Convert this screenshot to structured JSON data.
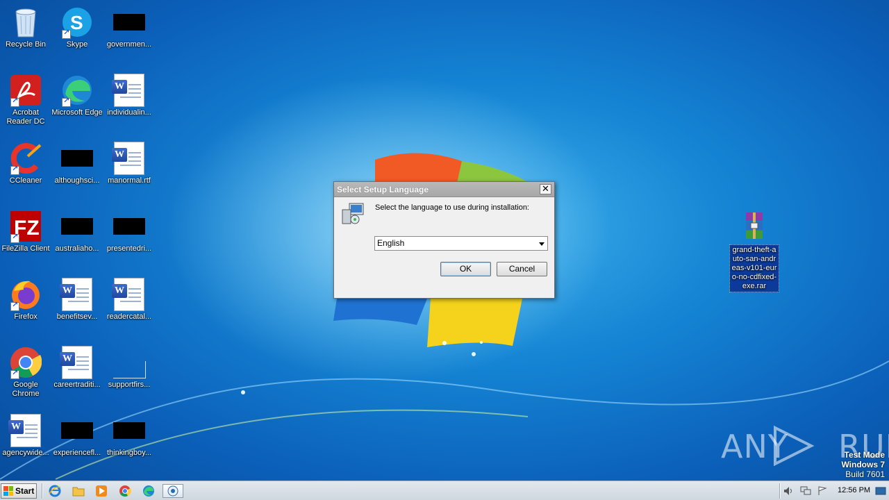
{
  "desktop_icons": [
    {
      "label": "Recycle Bin"
    },
    {
      "label": "Skype"
    },
    {
      "label": "governmen..."
    },
    {
      "label": "Acrobat Reader DC"
    },
    {
      "label": "Microsoft Edge"
    },
    {
      "label": "individualin..."
    },
    {
      "label": "CCleaner"
    },
    {
      "label": "althoughsci..."
    },
    {
      "label": "manormal.rtf"
    },
    {
      "label": "FileZilla Client"
    },
    {
      "label": "australiaho..."
    },
    {
      "label": "presentedri..."
    },
    {
      "label": "Firefox"
    },
    {
      "label": "benefitsev..."
    },
    {
      "label": "readercatal..."
    },
    {
      "label": "Google Chrome"
    },
    {
      "label": "careertraditi..."
    },
    {
      "label": "supportfirs..."
    },
    {
      "label": "agencywide..."
    },
    {
      "label": "experiencefl..."
    },
    {
      "label": "thinkingboy..."
    },
    {
      "label": "grand-theft-auto-san-andreas-v101-euro-no-cdfixed-exe.rar"
    }
  ],
  "dialog": {
    "title": "Select Setup Language",
    "close_label": "✕",
    "prompt": "Select the language to use during installation:",
    "language_selected": "English",
    "ok_label": "OK",
    "cancel_label": "Cancel"
  },
  "watermark": {
    "left": "ANY",
    "right": "RUN"
  },
  "test_mode": {
    "line1": "Test Mode",
    "line2": "Windows 7",
    "line3": "Build 7601"
  },
  "taskbar": {
    "start_label": "Start",
    "pinned": [
      "ie-icon",
      "explorer-icon",
      "media-player-icon",
      "chrome-icon",
      "edge-icon",
      "setup-icon"
    ],
    "clock": "12:56 PM"
  },
  "colors": {
    "wallpaper_blue": "#1585d4",
    "taskbar": "#d8dfe6",
    "dialog_title": "#a9a9a9"
  }
}
